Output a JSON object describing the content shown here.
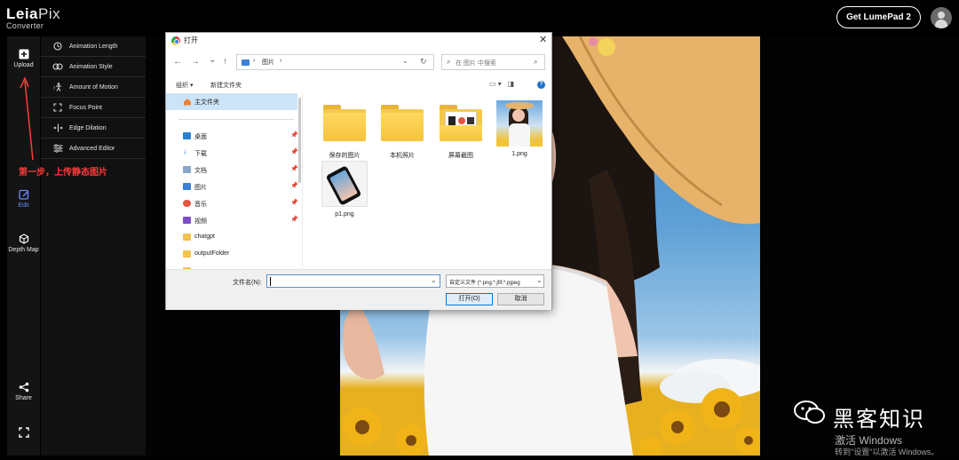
{
  "app": {
    "logo_bold": "Leia",
    "logo_light": "Pix",
    "logo_sub": "Converter",
    "cta_label": "Get LumePad 2",
    "rail": [
      {
        "label": "Upload",
        "icon": "plus-square-icon"
      },
      {
        "label": "Edit",
        "icon": "edit-icon"
      },
      {
        "label": "Depth Map",
        "icon": "depth-map-icon"
      },
      {
        "label": "Share",
        "icon": "share-icon"
      },
      {
        "label": "",
        "icon": "fullscreen-icon"
      }
    ],
    "tools": [
      {
        "label": "Animation Length",
        "icon": "clock-icon"
      },
      {
        "label": "Animation Style",
        "icon": "infinity-icon"
      },
      {
        "label": "Amount of Motion",
        "icon": "motion-icon"
      },
      {
        "label": "Focus Point",
        "icon": "focus-icon"
      },
      {
        "label": "Edge Dilation",
        "icon": "edge-dilation-icon"
      },
      {
        "label": "Advanced Editor",
        "icon": "sliders-icon"
      }
    ]
  },
  "annotation": "第一步，上传静态图片",
  "watermark": {
    "title": "黑客知识",
    "activate": "激活 Windows",
    "activate_hint": "转到\"设置\"以激活 Windows。"
  },
  "dialog": {
    "title": "打开",
    "close": "✕",
    "nav": {
      "back": "←",
      "forward": "→",
      "dropdown": "⌄",
      "up": "↑"
    },
    "address": {
      "crumbs": [
        "›",
        "图片",
        "›"
      ],
      "dropdown": "⌄",
      "refresh": "↻"
    },
    "search_placeholder": "在 图片 中搜索",
    "commands": {
      "organize": "组织 ▾",
      "new_folder": "新建文件夹",
      "help": "?"
    },
    "nav_items": [
      {
        "label": "主文件夹",
        "icon": "home-icon",
        "pinned": false
      },
      {
        "label": "桌面",
        "icon": "desktop-icon",
        "pinned": true
      },
      {
        "label": "下载",
        "icon": "download-icon",
        "pinned": true
      },
      {
        "label": "文档",
        "icon": "document-icon",
        "pinned": true
      },
      {
        "label": "图片",
        "icon": "pictures-icon",
        "pinned": true
      },
      {
        "label": "音乐",
        "icon": "music-icon",
        "pinned": true
      },
      {
        "label": "视频",
        "icon": "video-icon",
        "pinned": true
      },
      {
        "label": "chatgpt",
        "icon": "folder-icon",
        "pinned": false
      },
      {
        "label": "outputFolder",
        "icon": "folder-icon",
        "pinned": false
      }
    ],
    "files": [
      {
        "name": "保存的图片",
        "kind": "folder"
      },
      {
        "name": "本机照片",
        "kind": "folder"
      },
      {
        "name": "屏幕截图",
        "kind": "folder-preview"
      },
      {
        "name": "1.png",
        "kind": "image"
      },
      {
        "name": "p1.png",
        "kind": "image"
      }
    ],
    "filename_label": "文件名(N):",
    "filename_value": "",
    "filter_value": "自定义文件 (*.png;*.jfif;*.pjpeg",
    "open_label": "打开(O)",
    "cancel_label": "取消"
  },
  "colors": {
    "accent": "#6c8cff",
    "annotation": "#ff3b3b",
    "selection": "#cce4f7"
  }
}
